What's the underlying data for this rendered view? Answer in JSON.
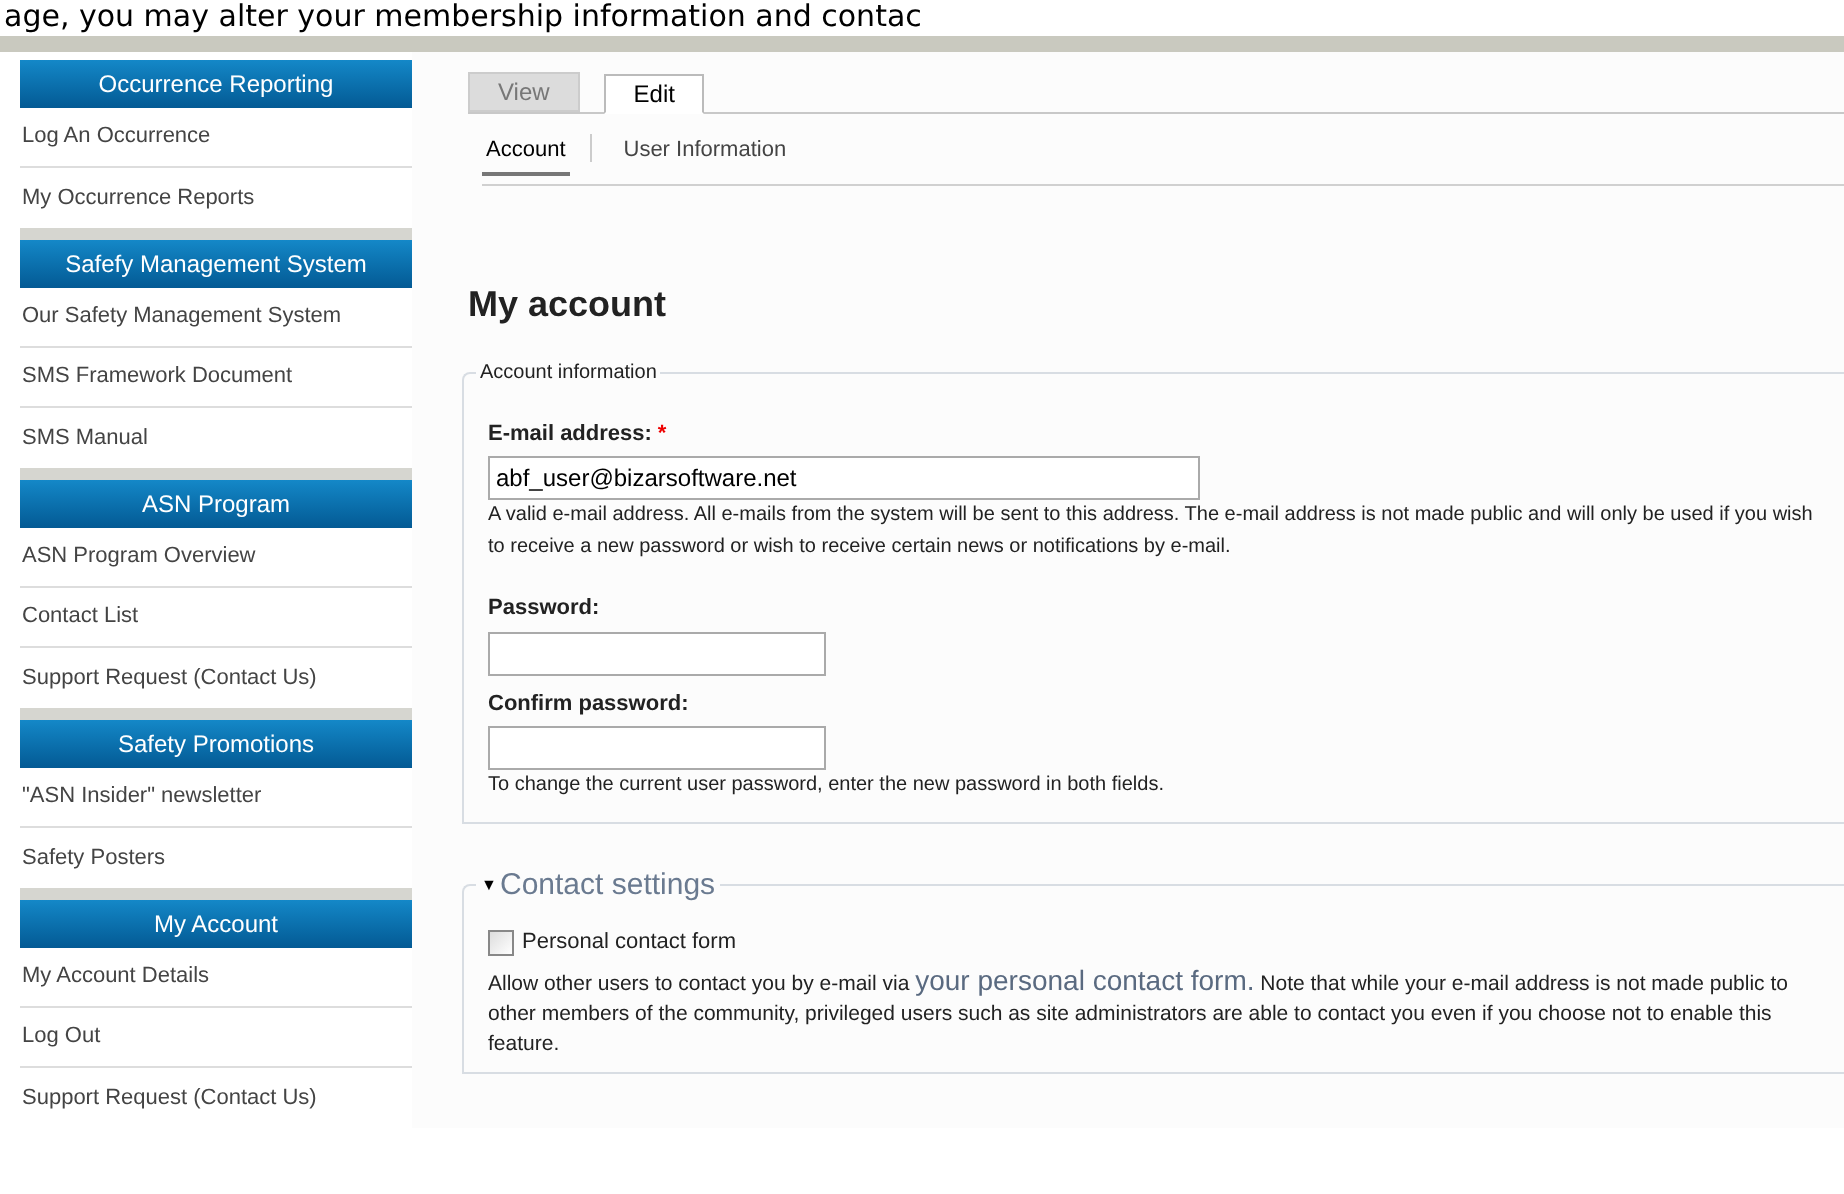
{
  "intro_text": "age, you may alter your membership information and contac",
  "sidebar": {
    "sections": [
      {
        "title": "Occurrence Reporting",
        "items": [
          "Log An Occurrence",
          "My Occurrence Reports"
        ]
      },
      {
        "title": "Safefy Management System",
        "items": [
          "Our Safety Management System",
          "SMS Framework Document",
          "SMS Manual"
        ]
      },
      {
        "title": "ASN Program",
        "items": [
          "ASN Program Overview",
          "Contact List",
          "Support Request (Contact Us)"
        ]
      },
      {
        "title": "Safety Promotions",
        "items": [
          "\"ASN Insider\" newsletter",
          "Safety Posters"
        ]
      },
      {
        "title": "My Account",
        "items": [
          "My Account Details",
          "Log Out",
          "Support Request (Contact Us)"
        ]
      }
    ]
  },
  "tabs": [
    {
      "label": "View",
      "selected": false
    },
    {
      "label": "Edit",
      "selected": true
    }
  ],
  "subtabs": [
    {
      "label": "Account",
      "selected": true
    },
    {
      "label": "User Information",
      "selected": false
    }
  ],
  "heading": "My account",
  "account_information": {
    "legend": "Account information",
    "fields": [
      {
        "label": "E-mail address:",
        "required_mark": "*",
        "kind": "email",
        "value": "abf_user@bizarsoftware.net",
        "description": "A valid e-mail address. All e-mails from the system will be sent to this address. The e-mail address is not made public and will only be used if you wish to receive a new password or wish to receive certain news or notifications by e-mail."
      },
      {
        "label": "Password:",
        "kind": "password"
      },
      {
        "label": "Confirm password:",
        "kind": "password",
        "description": "To change the current user password, enter the new password in both fields."
      }
    ]
  },
  "contact_settings": {
    "legend": "Contact settings",
    "caret": "▼",
    "expanded": true,
    "checkbox": {
      "label": "Personal contact form",
      "checked": false
    },
    "description": "Allow other users to contact you by e-mail via",
    "link": "your personal contact form.",
    "description_rest": "Note that while your e-mail address is not made public to other members of the community, privileged users such as site administrators are able to contact you even if you choose not to enable this feature."
  }
}
